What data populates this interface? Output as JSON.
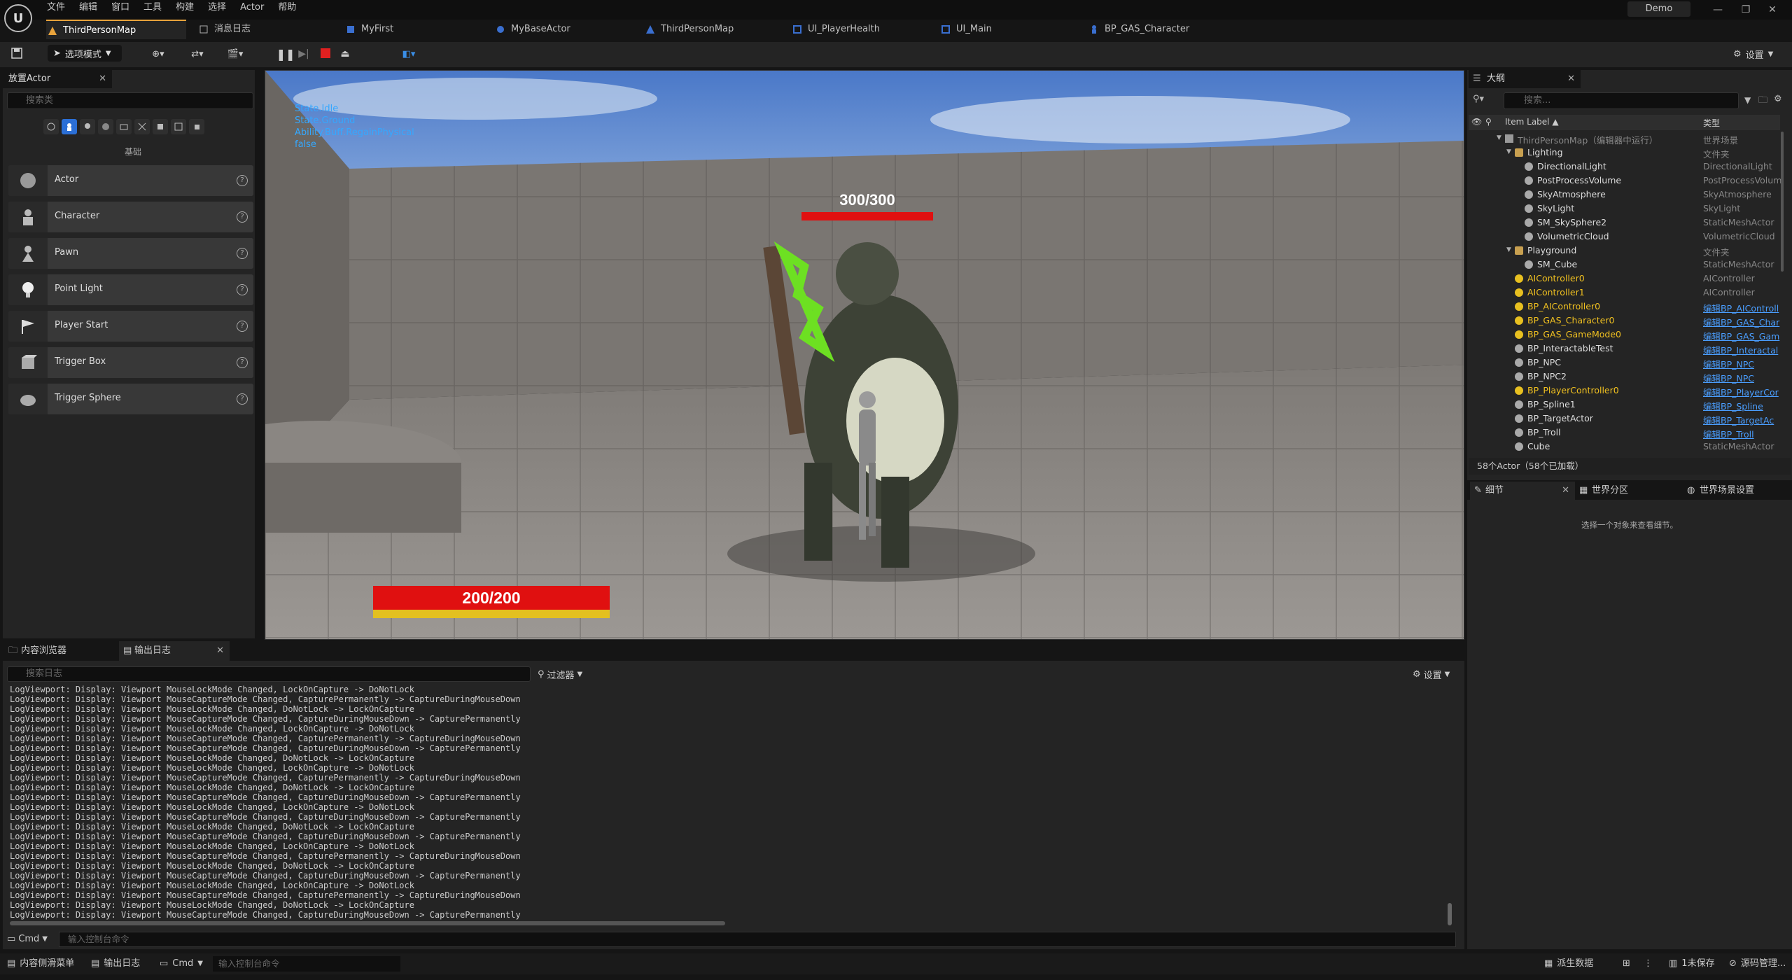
{
  "window": {
    "project": "Demo",
    "menu": [
      "文件",
      "编辑",
      "窗口",
      "工具",
      "构建",
      "选择",
      "Actor",
      "帮助"
    ]
  },
  "tabs": [
    "ThirdPersonMap",
    "消息日志",
    "MyFirst",
    "MyBaseActor",
    "ThirdPersonMap",
    "UI_PlayerHealth",
    "UI_Main",
    "BP_GAS_Character"
  ],
  "toolbar": {
    "mode": "选项模式",
    "settings": "设置"
  },
  "place_actors": {
    "title": "放置Actor",
    "search_placeholder": "搜索类",
    "category": "基础",
    "items": [
      "Actor",
      "Character",
      "Pawn",
      "Point Light",
      "Player Start",
      "Trigger Box",
      "Trigger Sphere"
    ]
  },
  "viewport": {
    "debug": [
      "State.Idle",
      "State.Ground",
      "Ability.Buff.RegainPhysical",
      "false"
    ],
    "enemy_hp": "300/300",
    "enemy_hp_fraction": 1.0,
    "player_hp": "200/200",
    "player_hp_fraction": 1.0
  },
  "outliner": {
    "title": "大纲",
    "search_placeholder": "搜索...",
    "col_label": "Item Label ▲",
    "col_type": "类型",
    "rows": [
      {
        "label": "ThirdPersonMap（编辑器中运行）",
        "type": "世界场景",
        "indent": 0,
        "kind": "world"
      },
      {
        "label": "Lighting",
        "type": "文件夹",
        "indent": 1,
        "kind": "folder"
      },
      {
        "label": "DirectionalLight",
        "type": "DirectionalLight",
        "indent": 2,
        "kind": "actor"
      },
      {
        "label": "PostProcessVolume",
        "type": "PostProcessVolum",
        "indent": 2,
        "kind": "actor"
      },
      {
        "label": "SkyAtmosphere",
        "type": "SkyAtmosphere",
        "indent": 2,
        "kind": "actor"
      },
      {
        "label": "SkyLight",
        "type": "SkyLight",
        "indent": 2,
        "kind": "actor"
      },
      {
        "label": "SM_SkySphere2",
        "type": "StaticMeshActor",
        "indent": 2,
        "kind": "actor"
      },
      {
        "label": "VolumetricCloud",
        "type": "VolumetricCloud",
        "indent": 2,
        "kind": "actor"
      },
      {
        "label": "Playground",
        "type": "文件夹",
        "indent": 1,
        "kind": "folder"
      },
      {
        "label": "SM_Cube",
        "type": "StaticMeshActor",
        "indent": 2,
        "kind": "actor"
      },
      {
        "label": "AIController0",
        "type": "AIController",
        "indent": 1,
        "kind": "runtime"
      },
      {
        "label": "AIController1",
        "type": "AIController",
        "indent": 1,
        "kind": "runtime"
      },
      {
        "label": "BP_AIController0",
        "type": "编辑BP_AIControll",
        "indent": 1,
        "kind": "runtime",
        "link": true
      },
      {
        "label": "BP_GAS_Character0",
        "type": "编辑BP_GAS_Char",
        "indent": 1,
        "kind": "runtime",
        "link": true
      },
      {
        "label": "BP_GAS_GameMode0",
        "type": "编辑BP_GAS_Gam",
        "indent": 1,
        "kind": "runtime",
        "link": true
      },
      {
        "label": "BP_InteractableTest",
        "type": "编辑BP_Interactal",
        "indent": 1,
        "kind": "actor",
        "link": true
      },
      {
        "label": "BP_NPC",
        "type": "编辑BP_NPC",
        "indent": 1,
        "kind": "actor",
        "link": true
      },
      {
        "label": "BP_NPC2",
        "type": "编辑BP_NPC",
        "indent": 1,
        "kind": "actor",
        "link": true
      },
      {
        "label": "BP_PlayerController0",
        "type": "编辑BP_PlayerCor",
        "indent": 1,
        "kind": "runtime",
        "link": true
      },
      {
        "label": "BP_Spline1",
        "type": "编辑BP_Spline",
        "indent": 1,
        "kind": "actor",
        "link": true
      },
      {
        "label": "BP_TargetActor",
        "type": "编辑BP_TargetAc",
        "indent": 1,
        "kind": "actor",
        "link": true
      },
      {
        "label": "BP_Troll",
        "type": "编辑BP_Troll",
        "indent": 1,
        "kind": "actor",
        "link": true
      },
      {
        "label": "Cube",
        "type": "StaticMeshActor",
        "indent": 1,
        "kind": "actor"
      }
    ],
    "status": "58个Actor（58个已加载）"
  },
  "details": {
    "tabs": [
      "细节",
      "世界分区",
      "世界场景设置"
    ],
    "empty": "选择一个对象来查看细节。"
  },
  "output": {
    "tabs": [
      "内容浏览器",
      "输出日志"
    ],
    "search_placeholder": "搜索日志",
    "filter": "过滤器",
    "settings": "设置",
    "lines": [
      "LogViewport: Display: Viewport MouseLockMode Changed, LockOnCapture -> DoNotLock",
      "LogViewport: Display: Viewport MouseCaptureMode Changed, CapturePermanently -> CaptureDuringMouseDown",
      "LogViewport: Display: Viewport MouseLockMode Changed, DoNotLock -> LockOnCapture",
      "LogViewport: Display: Viewport MouseCaptureMode Changed, CaptureDuringMouseDown -> CapturePermanently",
      "LogViewport: Display: Viewport MouseLockMode Changed, LockOnCapture -> DoNotLock",
      "LogViewport: Display: Viewport MouseCaptureMode Changed, CapturePermanently -> CaptureDuringMouseDown",
      "LogViewport: Display: Viewport MouseCaptureMode Changed, CaptureDuringMouseDown -> CapturePermanently",
      "LogViewport: Display: Viewport MouseLockMode Changed, DoNotLock -> LockOnCapture",
      "LogViewport: Display: Viewport MouseLockMode Changed, LockOnCapture -> DoNotLock",
      "LogViewport: Display: Viewport MouseCaptureMode Changed, CapturePermanently -> CaptureDuringMouseDown",
      "LogViewport: Display: Viewport MouseLockMode Changed, DoNotLock -> LockOnCapture",
      "LogViewport: Display: Viewport MouseCaptureMode Changed, CaptureDuringMouseDown -> CapturePermanently",
      "LogViewport: Display: Viewport MouseLockMode Changed, LockOnCapture -> DoNotLock",
      "LogViewport: Display: Viewport MouseCaptureMode Changed, CaptureDuringMouseDown -> CapturePermanently",
      "LogViewport: Display: Viewport MouseLockMode Changed, DoNotLock -> LockOnCapture",
      "LogViewport: Display: Viewport MouseCaptureMode Changed, CaptureDuringMouseDown -> CapturePermanently",
      "LogViewport: Display: Viewport MouseLockMode Changed, LockOnCapture -> DoNotLock",
      "LogViewport: Display: Viewport MouseCaptureMode Changed, CapturePermanently -> CaptureDuringMouseDown",
      "LogViewport: Display: Viewport MouseLockMode Changed, DoNotLock -> LockOnCapture",
      "LogViewport: Display: Viewport MouseCaptureMode Changed, CaptureDuringMouseDown -> CapturePermanently",
      "LogViewport: Display: Viewport MouseLockMode Changed, LockOnCapture -> DoNotLock",
      "LogViewport: Display: Viewport MouseCaptureMode Changed, CapturePermanently -> CaptureDuringMouseDown",
      "LogViewport: Display: Viewport MouseLockMode Changed, DoNotLock -> LockOnCapture",
      "LogViewport: Display: Viewport MouseCaptureMode Changed, CaptureDuringMouseDown -> CapturePermanently"
    ],
    "cmd": "Cmd",
    "cmd_placeholder": "输入控制台命令"
  },
  "statusbar": {
    "drawer": "内容侧滑菜单",
    "output_log": "输出日志",
    "cmd": "Cmd",
    "cmd_placeholder": "输入控制台命令",
    "derived": "派生数据",
    "unsaved": "1未保存",
    "source_control": "源码管理..."
  }
}
